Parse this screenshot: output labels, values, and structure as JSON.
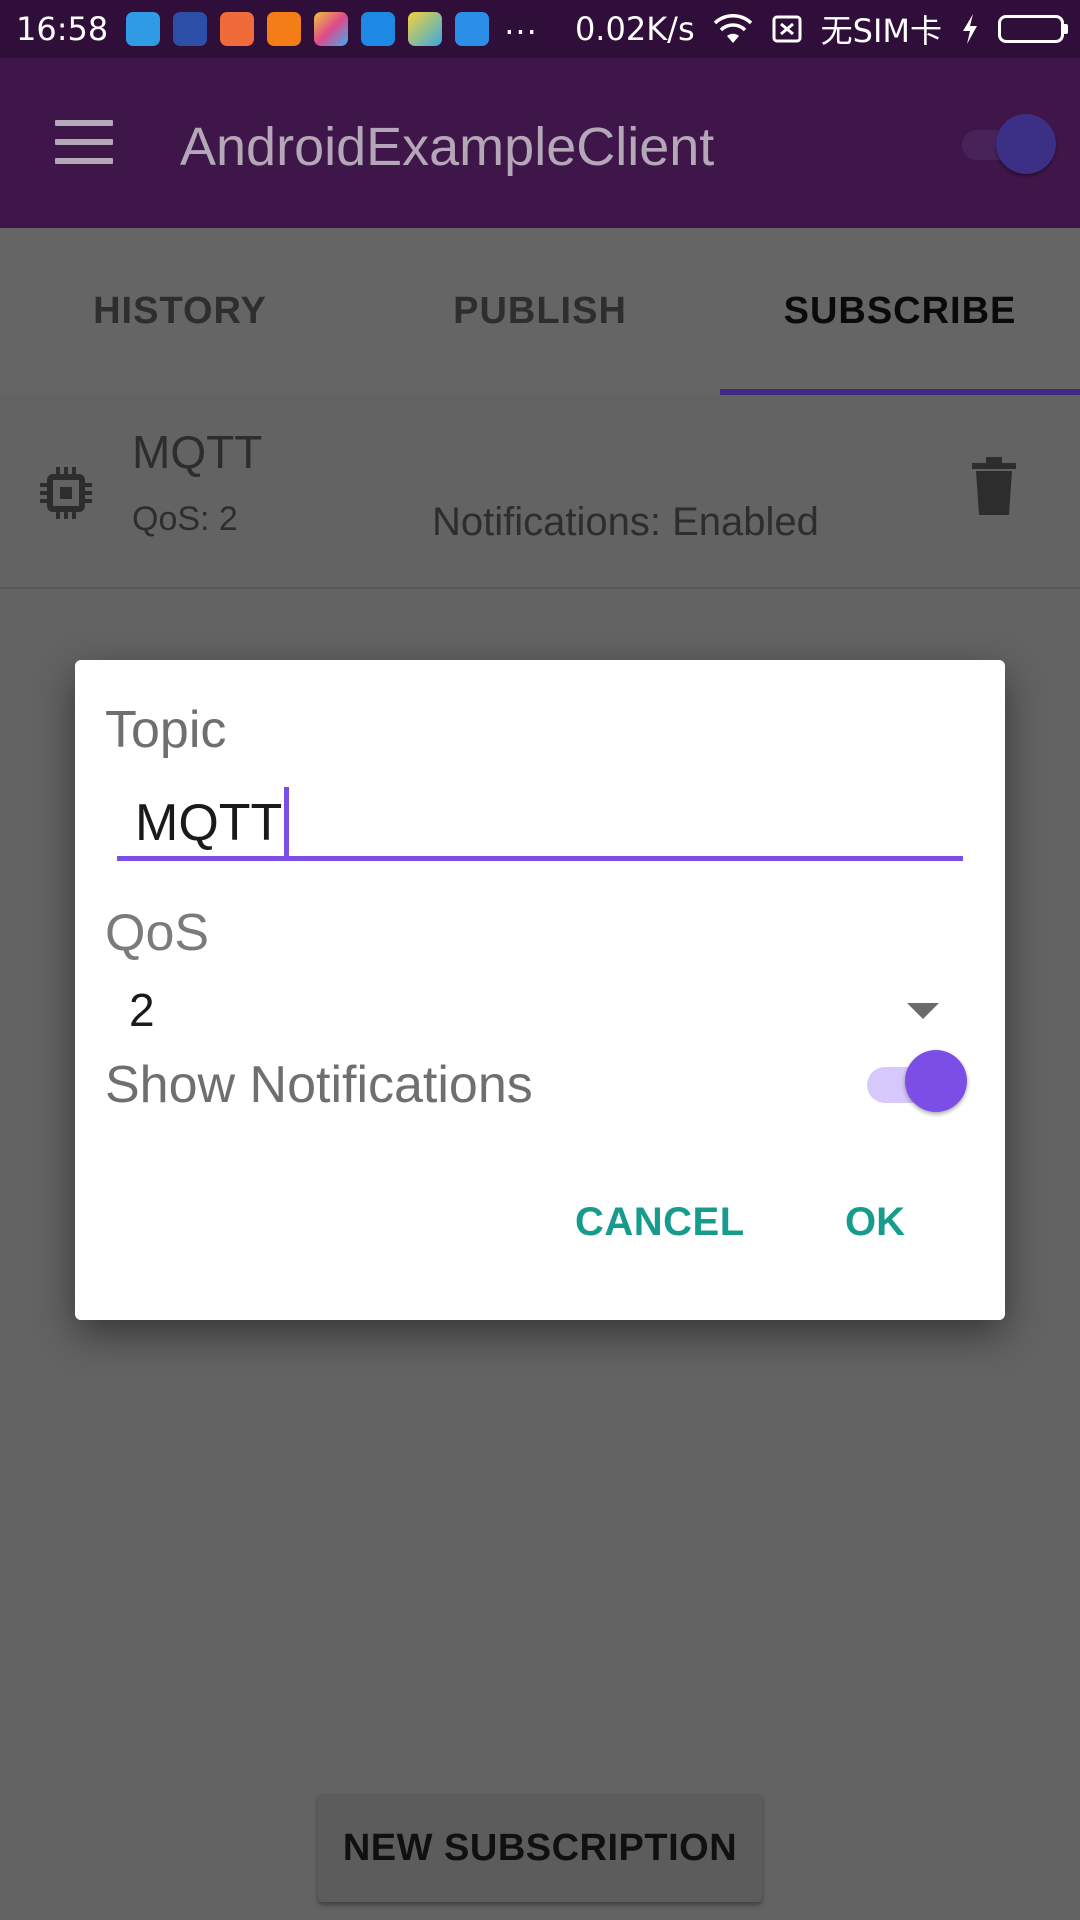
{
  "status_bar": {
    "time": "16:58",
    "net_speed": "0.02K/s",
    "sim_status": "无SIM卡",
    "more_indicator": "...",
    "notification_icons": [
      {
        "name": "usb-icon",
        "color": "#2f9be5"
      },
      {
        "name": "news-app-icon",
        "color": "#2c4ea6"
      },
      {
        "name": "mi-store-icon",
        "color": "#f06a3a"
      },
      {
        "name": "reader-app-icon",
        "color": "#f57d17"
      },
      {
        "name": "gallery-app-icon",
        "color": "#f0c33a"
      },
      {
        "name": "chart-app-icon",
        "color": "#1e88e5"
      },
      {
        "name": "telegram-icon",
        "color": "#38a8e0"
      },
      {
        "name": "blue-app-icon",
        "color": "#2b8fe8"
      }
    ],
    "battery_color": "#5ed72f"
  },
  "app_bar": {
    "title": "AndroidExampleClient",
    "background": "#3f1649"
  },
  "tabs": [
    {
      "label": "HISTORY",
      "active": false
    },
    {
      "label": "PUBLISH",
      "active": false
    },
    {
      "label": "SUBSCRIBE",
      "active": true
    }
  ],
  "subscription": {
    "topic": "MQTT",
    "qos": "QoS: 2",
    "notifications": "Notifications: Enabled"
  },
  "dialog": {
    "topic_label": "Topic",
    "topic_value": "MQTT",
    "qos_label": "QoS",
    "qos_value": "2",
    "notifications_label": "Show Notifications",
    "notifications_enabled": true,
    "cancel_label": "CANCEL",
    "ok_label": "OK",
    "accent_color": "#7b4fe6",
    "button_color": "#179b8c"
  },
  "new_subscription_label": "NEW SUBSCRIPTION"
}
